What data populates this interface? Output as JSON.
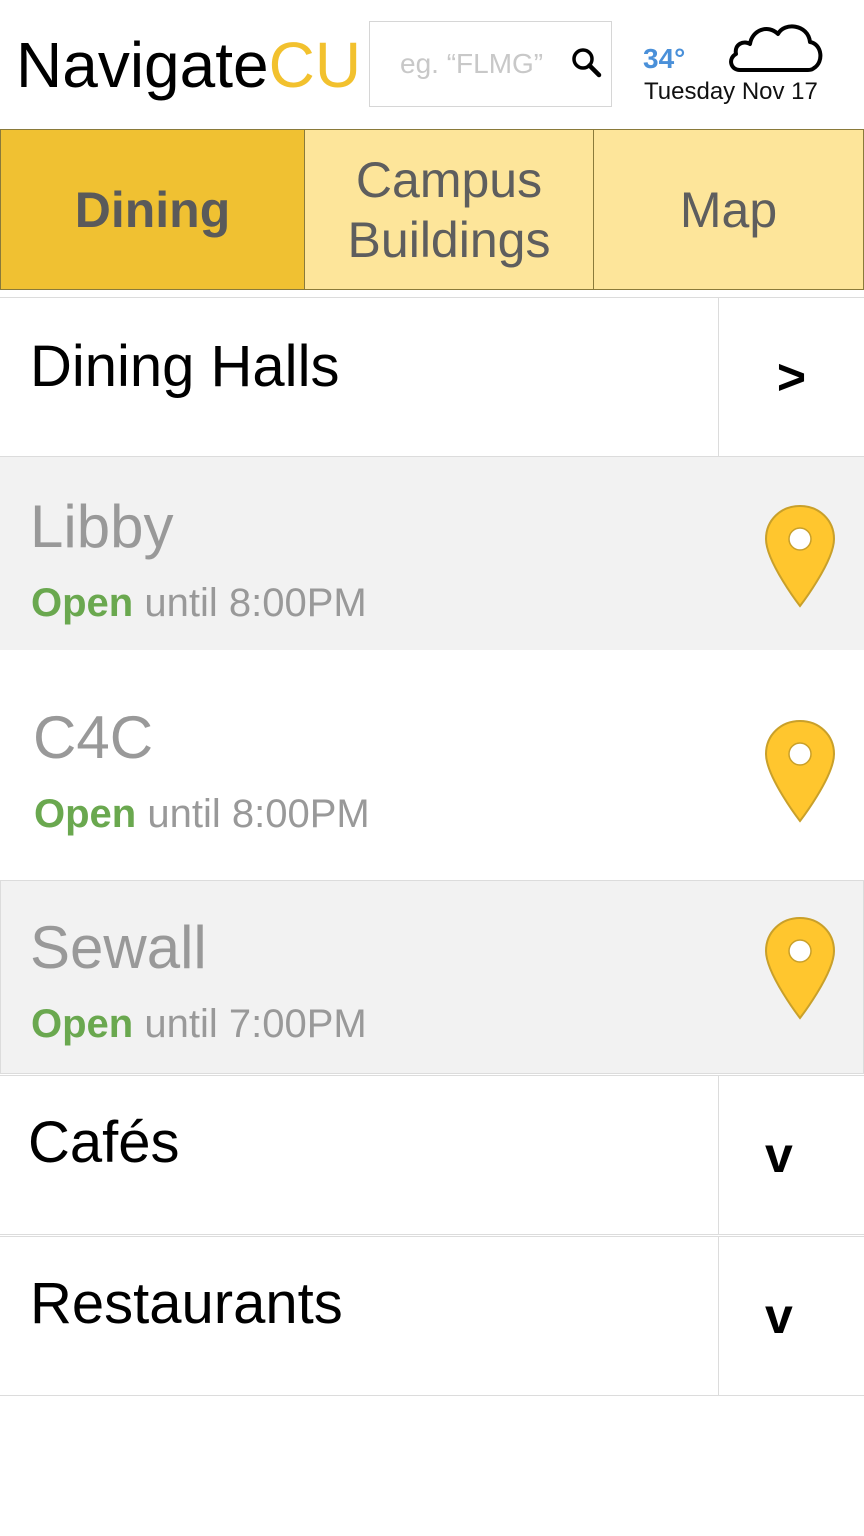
{
  "header": {
    "logo_main": "Navigate",
    "logo_accent": "CU",
    "search_placeholder": "eg. “FLMG”",
    "search_icon": "search-icon",
    "temperature": "34°",
    "date": "Tuesday Nov 17",
    "weather_icon": "cloud-icon"
  },
  "tabs": [
    {
      "label": "Dining",
      "active": true
    },
    {
      "label_line1": "Campus",
      "label_line2": "Buildings",
      "active": false
    },
    {
      "label": "Map",
      "active": false
    }
  ],
  "sections": {
    "dining_halls": {
      "label": "Dining Halls",
      "toggle": ">",
      "items": [
        {
          "name": "Libby",
          "status_word": "Open",
          "status_detail": " until 8:00PM",
          "icon": "map-pin-icon"
        },
        {
          "name": "C4C",
          "status_word": "Open",
          "status_detail": " until 8:00PM",
          "icon": "map-pin-icon"
        },
        {
          "name": "Sewall",
          "status_word": "Open",
          "status_detail": " until 7:00PM",
          "icon": "map-pin-icon"
        }
      ]
    },
    "cafes": {
      "label": "Cafés",
      "toggle": "v"
    },
    "restaurants": {
      "label": "Restaurants",
      "toggle": "v"
    }
  },
  "colors": {
    "accent": "#f2c12e",
    "tab_active": "#f0c132",
    "tab_inactive": "#fde59a",
    "open_green": "#6aa84f",
    "temperature_blue": "#4a90d9",
    "pin_yellow": "#ffc62e",
    "row_gray": "#f2f2f2"
  }
}
